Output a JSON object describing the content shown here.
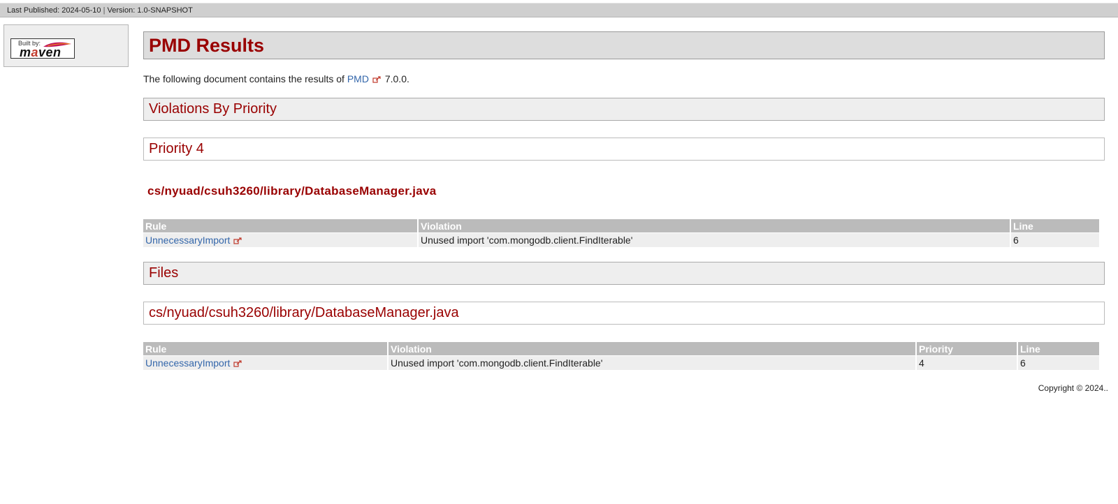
{
  "banner": {
    "published": "Last Published: 2024-05-10",
    "separator": "|",
    "version": "Version: 1.0-SNAPSHOT"
  },
  "badge": {
    "built_by": "Built by:",
    "maven_pre": "m",
    "maven_accent": "a",
    "maven_post": "ven"
  },
  "page": {
    "title": "PMD Results",
    "intro_prefix": "The following document contains the results of",
    "intro_link": "PMD",
    "intro_suffix": "7.0.0."
  },
  "sections": {
    "violations_by_priority": "Violations By Priority",
    "priority_heading": "Priority 4",
    "priority_file": "cs/nyuad/csuh3260/library/DatabaseManager.java",
    "files": "Files",
    "files_file": "cs/nyuad/csuh3260/library/DatabaseManager.java"
  },
  "priority_table": {
    "headers": [
      "Rule",
      "Violation",
      "Line"
    ],
    "rows": [
      {
        "rule": "UnnecessaryImport",
        "violation": "Unused import 'com.mongodb.client.FindIterable'",
        "line": "6"
      }
    ]
  },
  "files_table": {
    "headers": [
      "Rule",
      "Violation",
      "Priority",
      "Line"
    ],
    "rows": [
      {
        "rule": "UnnecessaryImport",
        "violation": "Unused import 'com.mongodb.client.FindIterable'",
        "priority": "4",
        "line": "6"
      }
    ]
  },
  "footer": {
    "copyright": "Copyright © 2024.."
  },
  "colors": {
    "heading": "#990000",
    "link": "#3366aa",
    "table_header": "#bbbbbb",
    "row_bg": "#eeeeee"
  },
  "icons": {
    "external_link": "external-link-icon",
    "feather": "maven-feather-icon"
  }
}
